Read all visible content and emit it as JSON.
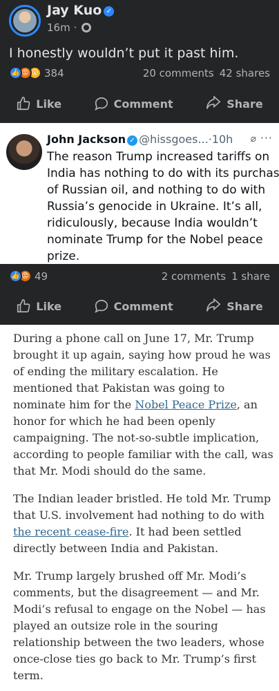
{
  "post1": {
    "author": "Jay Kuo",
    "time": "16m",
    "text": "I honestly wouldn’t put it past him.",
    "reaction_count": "384",
    "comments": "20 comments",
    "shares": "42 shares"
  },
  "actions": {
    "like": "Like",
    "comment": "Comment",
    "share": "Share"
  },
  "embed": {
    "author": "John Jackson",
    "handle": "@hissgoes...",
    "separator": "·",
    "time": "10h",
    "more": "···",
    "lines": [
      "The reason Trump increased tariffs on",
      "India has nothing to do with its purchase",
      "of Russian oil, and nothing to do with",
      "Russia’s genocide in Ukraine. It’s all,",
      "ridiculously, because India wouldn’t",
      "nominate Trump for the Nobel peace",
      "prize."
    ]
  },
  "post2": {
    "reaction_count": "49",
    "comments": "2 comments",
    "shares": "1 share"
  },
  "article": {
    "p1": {
      "l1": "During a phone call on June 17, Mr. Trump",
      "l2": "brought it up again, saying how proud he was",
      "l3": "of ending the military escalation. He",
      "l4": "mentioned that Pakistan was going to",
      "l5_pre": "nominate him for the ",
      "l5_link": "Nobel Peace Prize",
      "l5_post": ", an",
      "l6": "honor for which he had been openly",
      "l7": "campaigning. The not-so-subtle implication,",
      "l8": "according to people familiar with the call, was",
      "l9": "that Mr. Modi should do the same."
    },
    "p2": {
      "l1": "The Indian leader bristled. He told Mr. Trump",
      "l2": "that U.S. involvement had nothing to do with",
      "l3_link": "the recent cease-fire",
      "l3_post": ". It had been settled",
      "l4": "directly between India and Pakistan."
    },
    "p3": {
      "l1": "Mr. Trump largely brushed off Mr. Modi’s",
      "l2": "comments, but the disagreement — and Mr.",
      "l3": "Modi’s refusal to engage on the Nobel — has",
      "l4": "played an outsize role in the souring",
      "l5": "relationship between the two leaders, whose",
      "l6": "once-close ties go back to Mr. Trump’s first",
      "l7": "term."
    }
  },
  "colors": {
    "fb_dark": "#242526",
    "fb_text": "#e4e6eb",
    "fb_muted": "#b0b3b8",
    "verified_blue": "#2d88ff",
    "x_blue": "#1d9bf0",
    "nyt_link": "#326891"
  },
  "icons": [
    "verified-badge-icon",
    "globe-icon",
    "like-reaction-icon",
    "angry-reaction-icon",
    "wow-reaction-icon",
    "thumbs-up-icon",
    "comment-bubble-icon",
    "share-arrow-icon",
    "grok-icon",
    "more-icon"
  ]
}
